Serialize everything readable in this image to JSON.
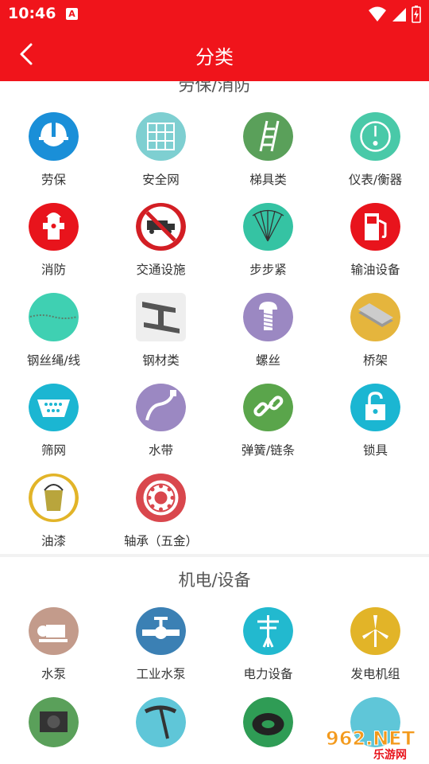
{
  "status": {
    "time": "10:46",
    "badge": "A"
  },
  "header": {
    "title": "分类"
  },
  "sections": [
    {
      "title": "劳保/消防",
      "items": [
        {
          "label": "劳保",
          "icon": "helmet-icon",
          "color": "#1a8fd8"
        },
        {
          "label": "安全网",
          "icon": "safety-net-icon",
          "color": "#7ecfd1"
        },
        {
          "label": "梯具类",
          "icon": "ladder-icon",
          "color": "#5aa05a"
        },
        {
          "label": "仪表/衡器",
          "icon": "gauge-icon",
          "color": "#49c9a8"
        },
        {
          "label": "消防",
          "icon": "fire-hydrant-icon",
          "color": "#e8141c"
        },
        {
          "label": "交通设施",
          "icon": "no-truck-sign-icon",
          "color": "#d31e24"
        },
        {
          "label": "步步紧",
          "icon": "cable-tie-icon",
          "color": "#35c3a3"
        },
        {
          "label": "输油设备",
          "icon": "fuel-pump-icon",
          "color": "#e8141c"
        },
        {
          "label": "钢丝绳/线",
          "icon": "wire-rope-icon",
          "color": "#3fd0b2"
        },
        {
          "label": "钢材类",
          "icon": "steel-beam-icon",
          "color": "#eeeeee"
        },
        {
          "label": "螺丝",
          "icon": "screw-icon",
          "color": "#9b88c2"
        },
        {
          "label": "桥架",
          "icon": "cable-tray-icon",
          "color": "#e5b53d"
        },
        {
          "label": "筛网",
          "icon": "sieve-icon",
          "color": "#1bb6d2"
        },
        {
          "label": "水带",
          "icon": "water-hose-icon",
          "color": "#9b88c2"
        },
        {
          "label": "弹簧/链条",
          "icon": "chain-icon",
          "color": "#5aa54b"
        },
        {
          "label": "锁具",
          "icon": "lock-icon",
          "color": "#1bb6d2"
        },
        {
          "label": "油漆",
          "icon": "paint-bucket-icon",
          "color": "#e2b428"
        },
        {
          "label": "轴承（五金）",
          "icon": "bearing-icon",
          "color": "#d9474d"
        }
      ]
    },
    {
      "title": "机电/设备",
      "items": [
        {
          "label": "水泵",
          "icon": "water-pump-icon",
          "color": "#c39b8b"
        },
        {
          "label": "工业水泵",
          "icon": "valve-icon",
          "color": "#3b80b4"
        },
        {
          "label": "电力设备",
          "icon": "power-pole-icon",
          "color": "#22b9cf"
        },
        {
          "label": "发电机组",
          "icon": "wind-turbine-icon",
          "color": "#e2b428"
        },
        {
          "label": "",
          "icon": "generator-icon",
          "color": "#5aa05a"
        },
        {
          "label": "",
          "icon": "pickaxe-icon",
          "color": "#5fc6d8"
        },
        {
          "label": "",
          "icon": "cable-coil-icon",
          "color": "#2f9c55"
        },
        {
          "label": "",
          "icon": "misc-icon",
          "color": "#5fc6d8"
        }
      ]
    }
  ],
  "watermark": {
    "text": "962.NET",
    "sub": "乐游网"
  }
}
